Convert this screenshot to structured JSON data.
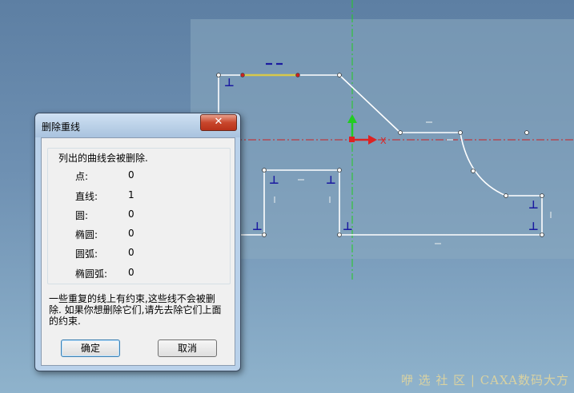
{
  "dialog": {
    "title": "删除重线",
    "close_label": "✕",
    "group_label": "列出的曲线会被删除.",
    "rows": [
      {
        "label": "点:",
        "value": "0"
      },
      {
        "label": "直线:",
        "value": "1"
      },
      {
        "label": "圆:",
        "value": "0"
      },
      {
        "label": "椭圆:",
        "value": "0"
      },
      {
        "label": "圆弧:",
        "value": "0"
      },
      {
        "label": "椭圆弧:",
        "value": "0"
      }
    ],
    "note": "一些重复的线上有约束,这些线不会被删除. 如果你想删除它们,请先去除它们上面的约束.",
    "ok_label": "确定",
    "cancel_label": "取消"
  },
  "sketch": {
    "axis_x_label": "X",
    "constraint_symbol": "⊥",
    "horizontal_symbol": "—",
    "selected_line_color": "#d7c84a"
  },
  "watermark": "咿 选 社 区  |  CAXA数码大方"
}
